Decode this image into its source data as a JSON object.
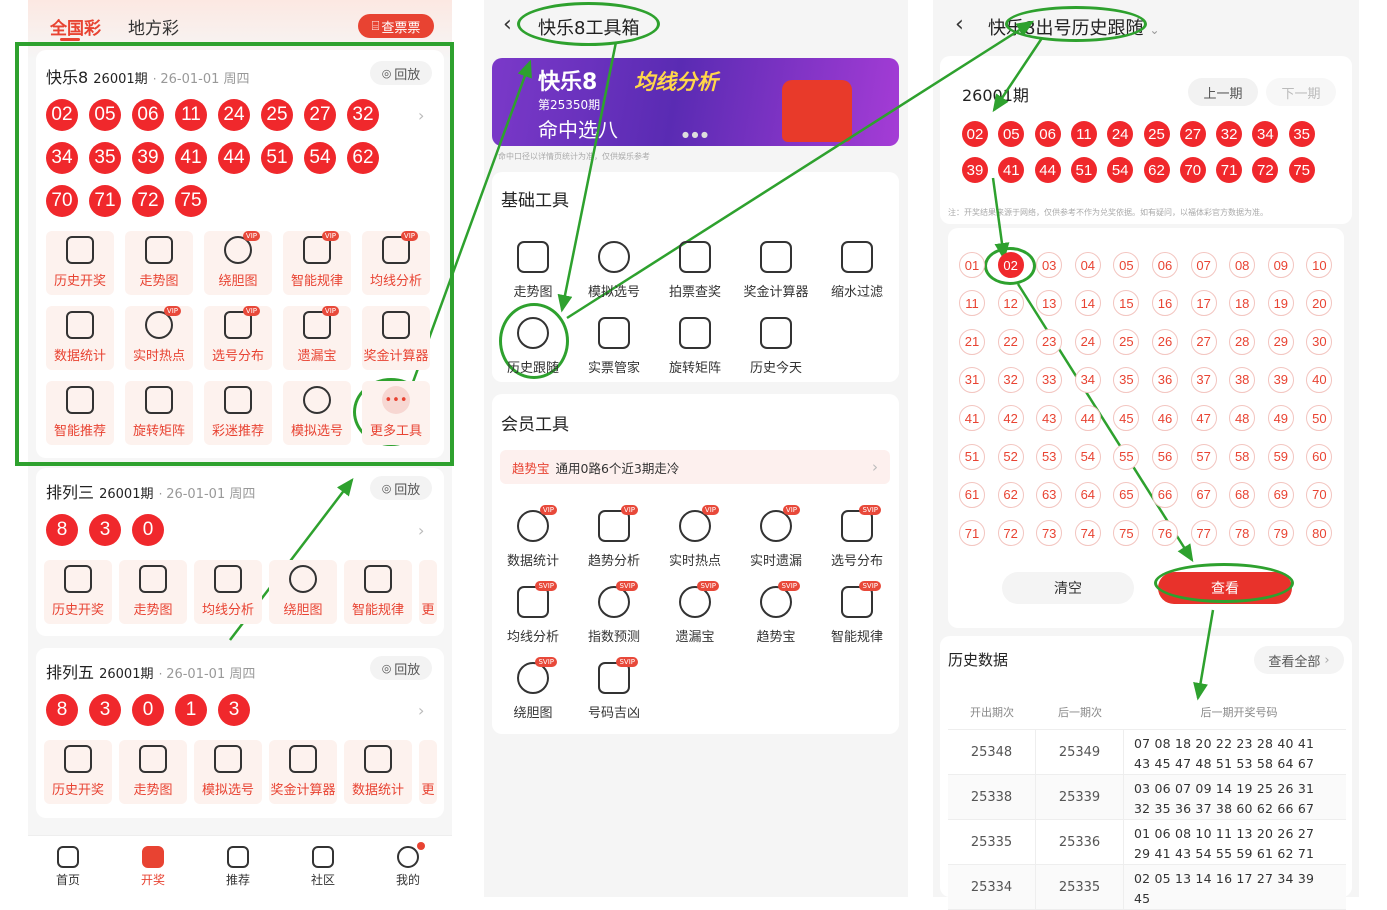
{
  "left": {
    "top_tabs": [
      "全国彩",
      "地方彩"
    ],
    "ticket_btn": "查票票",
    "kl8": {
      "name": "快乐8",
      "issue": "26001期",
      "date": "26-01-01 周四",
      "replay": "回放",
      "balls": [
        "02",
        "05",
        "06",
        "11",
        "24",
        "25",
        "27",
        "32",
        "34",
        "35",
        "39",
        "41",
        "44",
        "51",
        "54",
        "62",
        "70",
        "71",
        "72",
        "75"
      ],
      "tools": [
        "历史开奖",
        "走势图",
        "绕胆图",
        "智能规律",
        "均线分析",
        "数据统计",
        "实时热点",
        "选号分布",
        "遗漏宝",
        "奖金计算器",
        "智能推荐",
        "旋转矩阵",
        "彩迷推荐",
        "模拟选号",
        "更多工具"
      ],
      "tool_icons": [
        "trophy-icon",
        "trend-icon",
        "target-icon",
        "grid-icon",
        "bars-icon",
        "pie-icon",
        "fire-icon",
        "grid-icon",
        "bowl-icon",
        "calculator-icon",
        "robot-icon",
        "matrix-icon",
        "thumb-icon",
        "ball-icon",
        "more-icon"
      ]
    },
    "pl3": {
      "name": "排列三",
      "issue": "26001期",
      "date": "26-01-01 周四",
      "replay": "回放",
      "balls": [
        "8",
        "3",
        "0"
      ],
      "tools": [
        "历史开奖",
        "走势图",
        "均线分析",
        "绕胆图",
        "智能规律",
        "更"
      ]
    },
    "pl5": {
      "name": "排列五",
      "issue": "26001期",
      "date": "26-01-01 周四",
      "replay": "回放",
      "balls": [
        "8",
        "3",
        "0",
        "1",
        "3"
      ],
      "tools": [
        "历史开奖",
        "走势图",
        "模拟选号",
        "奖金计算器",
        "数据统计",
        "更"
      ]
    },
    "nav": [
      "首页",
      "开奖",
      "推荐",
      "社区",
      "我的"
    ]
  },
  "middle": {
    "title": "快乐8工具箱",
    "banner": {
      "brand": "快乐8",
      "tag": "均线分析",
      "issue": "第25350期",
      "slogan": "命中选八",
      "note": "命中口径以详情页统计为准，仅供娱乐参考"
    },
    "basic_title": "基础工具",
    "basic_tools": [
      "走势图",
      "模拟选号",
      "拍票查奖",
      "奖金计算器",
      "缩水过滤",
      "历史跟随",
      "实票管家",
      "旋转矩阵",
      "历史今天"
    ],
    "member_title": "会员工具",
    "member_banner": {
      "tag": "趋势宝",
      "text": "通用0路6个近3期走冷"
    },
    "member_tools": [
      "数据统计",
      "趋势分析",
      "实时热点",
      "实时遗漏",
      "选号分布",
      "均线分析",
      "指数预测",
      "遗漏宝",
      "趋势宝",
      "智能规律",
      "绕胆图",
      "号码吉凶"
    ]
  },
  "right": {
    "title": "快乐8出号历史跟随",
    "issue": "26001期",
    "prev": "上一期",
    "next": "下一期",
    "balls": [
      "02",
      "05",
      "06",
      "11",
      "24",
      "25",
      "27",
      "32",
      "34",
      "35",
      "39",
      "41",
      "44",
      "51",
      "54",
      "62",
      "70",
      "71",
      "72",
      "75"
    ],
    "disclaimer": "注：开奖结果来源于网络，仅供参考不作为兑奖依据。如有疑问，以福体彩官方数据为准。",
    "selected": "02",
    "clear": "清空",
    "view": "查看",
    "history_title": "历史数据",
    "view_all": "查看全部",
    "cols": [
      "开出期次",
      "后一期次",
      "后一期开奖号码"
    ],
    "rows": [
      {
        "a": "25348",
        "b": "25349",
        "nums": "07 08 18 20 22 23 28 40 41 43 45 47 48 51 53 58 64 67 78 80"
      },
      {
        "a": "25338",
        "b": "25339",
        "nums": "03 06 07 09 14 19 25 26 31 32 35 36 37 38 60 62 66 67 68 75"
      },
      {
        "a": "25335",
        "b": "25336",
        "nums": "01 06 08 10 11 13 20 26 27 29 41 43 54 55 59 61 62 71 76 80"
      },
      {
        "a": "25334",
        "b": "25335",
        "nums": "02 05 13 14 16 17 27 34 39 45"
      }
    ]
  },
  "colors": {
    "accent": "#f0282c",
    "annotation": "#2ea12e"
  }
}
